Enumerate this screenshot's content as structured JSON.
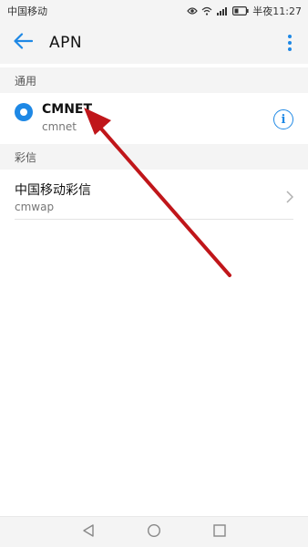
{
  "status_bar": {
    "carrier": "中国移动",
    "time_label": "半夜11:27"
  },
  "app_bar": {
    "title": "APN"
  },
  "sections": {
    "general": {
      "header": "通用",
      "apn": {
        "name": "CMNET",
        "subtitle": "cmnet",
        "selected": true
      }
    },
    "mms": {
      "header": "彩信",
      "apn": {
        "name": "中国移动彩信",
        "subtitle": "cmwap"
      }
    }
  },
  "colors": {
    "accent": "#1e88e5",
    "annotation_arrow": "#c0161a"
  }
}
